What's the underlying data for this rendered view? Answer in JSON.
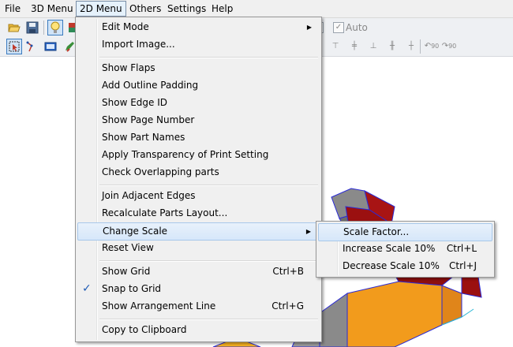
{
  "menubar": {
    "file": "File",
    "menu3d": "3D Menu",
    "menu2d": "2D Menu",
    "others": "Others",
    "settings": "Settings",
    "help": "Help"
  },
  "toolbar": {
    "auto_label": "Auto",
    "auto_checked": true,
    "rotate_left_label": "90",
    "rotate_right_label": "90"
  },
  "menu2d": {
    "items": [
      {
        "label": "Edit Mode",
        "submenu": true
      },
      {
        "label": "Import Image..."
      },
      {
        "label": "Show Flaps"
      },
      {
        "label": "Add Outline Padding"
      },
      {
        "label": "Show Edge ID"
      },
      {
        "label": "Show Page Number"
      },
      {
        "label": "Show Part Names"
      },
      {
        "label": "Apply Transparency of Print Setting"
      },
      {
        "label": "Check Overlapping parts"
      },
      {
        "label": "Join Adjacent Edges"
      },
      {
        "label": "Recalculate Parts Layout..."
      },
      {
        "label": "Change Scale",
        "submenu": true,
        "highlighted": true
      },
      {
        "label": "Reset View"
      },
      {
        "label": "Show Grid",
        "shortcut": "Ctrl+B"
      },
      {
        "label": "Snap to Grid",
        "checked": true
      },
      {
        "label": "Show Arrangement Line",
        "shortcut": "Ctrl+G"
      },
      {
        "label": "Copy to Clipboard"
      }
    ]
  },
  "scale_submenu": {
    "items": [
      {
        "label": "Scale Factor...",
        "highlighted": true
      },
      {
        "label": "Increase Scale 10%",
        "shortcut": "Ctrl+L"
      },
      {
        "label": "Decrease Scale 10%",
        "shortcut": "Ctrl+J"
      }
    ]
  },
  "colors": {
    "model_red": "#9b1010",
    "model_orange": "#f29b1c",
    "model_gray": "#8a8a8a",
    "edge_blue": "#2b2bd6",
    "highlight": "#d6e7fa"
  },
  "icons": {
    "open": "folder-open-icon",
    "save": "save-icon",
    "light": "lightbulb-icon",
    "select": "select-arrow-icon",
    "rotate_left": "rotate-left-icon",
    "rotate_right": "rotate-right-icon"
  }
}
